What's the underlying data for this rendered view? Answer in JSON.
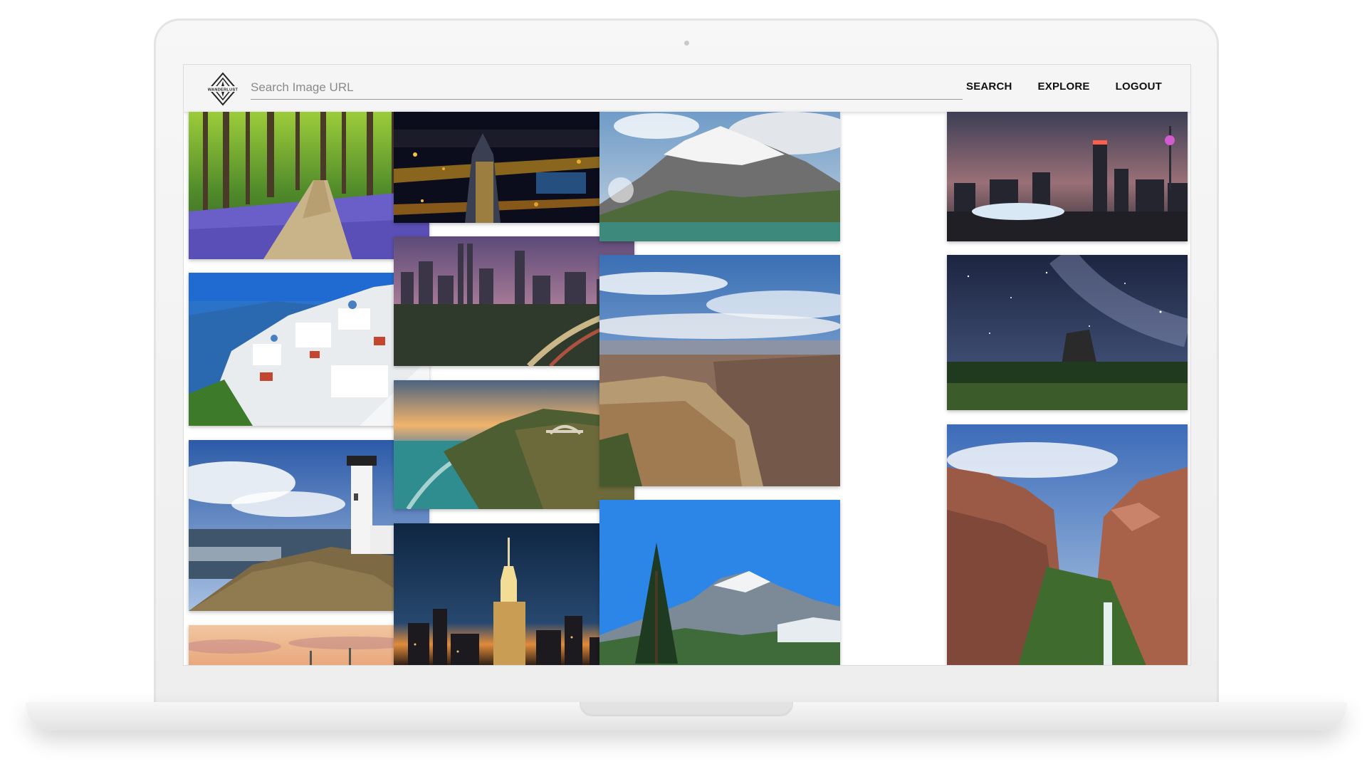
{
  "app": {
    "brand": "WANDERLUST",
    "search": {
      "placeholder": "Search Image URL",
      "value": ""
    },
    "nav": [
      "SEARCH",
      "EXPLORE",
      "LOGOUT"
    ]
  },
  "gallery": {
    "columns": [
      {
        "tiles": [
          "bluebell-forest-path",
          "santorini-white-village",
          "lighthouse-on-cliff",
          "sunset-sky-partial"
        ]
      },
      {
        "tiles": [
          "city-night-aerial",
          "kuala-lumpur-skyline-dusk",
          "big-sur-bixby-bridge",
          "empire-state-building-night"
        ]
      },
      {
        "tiles": [
          "snowy-mountain-lake",
          "grand-canyon-overlook",
          "glacier-pine-mountain"
        ]
      },
      {
        "tiles": [
          "johannesburg-skyline-dusk",
          "devils-tower-milky-way",
          "canyon-waterfall"
        ]
      }
    ]
  },
  "colors": {
    "header_bg": "#f5f5f5",
    "nav_text": "#111111",
    "accent_line": "#9a9a9a"
  }
}
